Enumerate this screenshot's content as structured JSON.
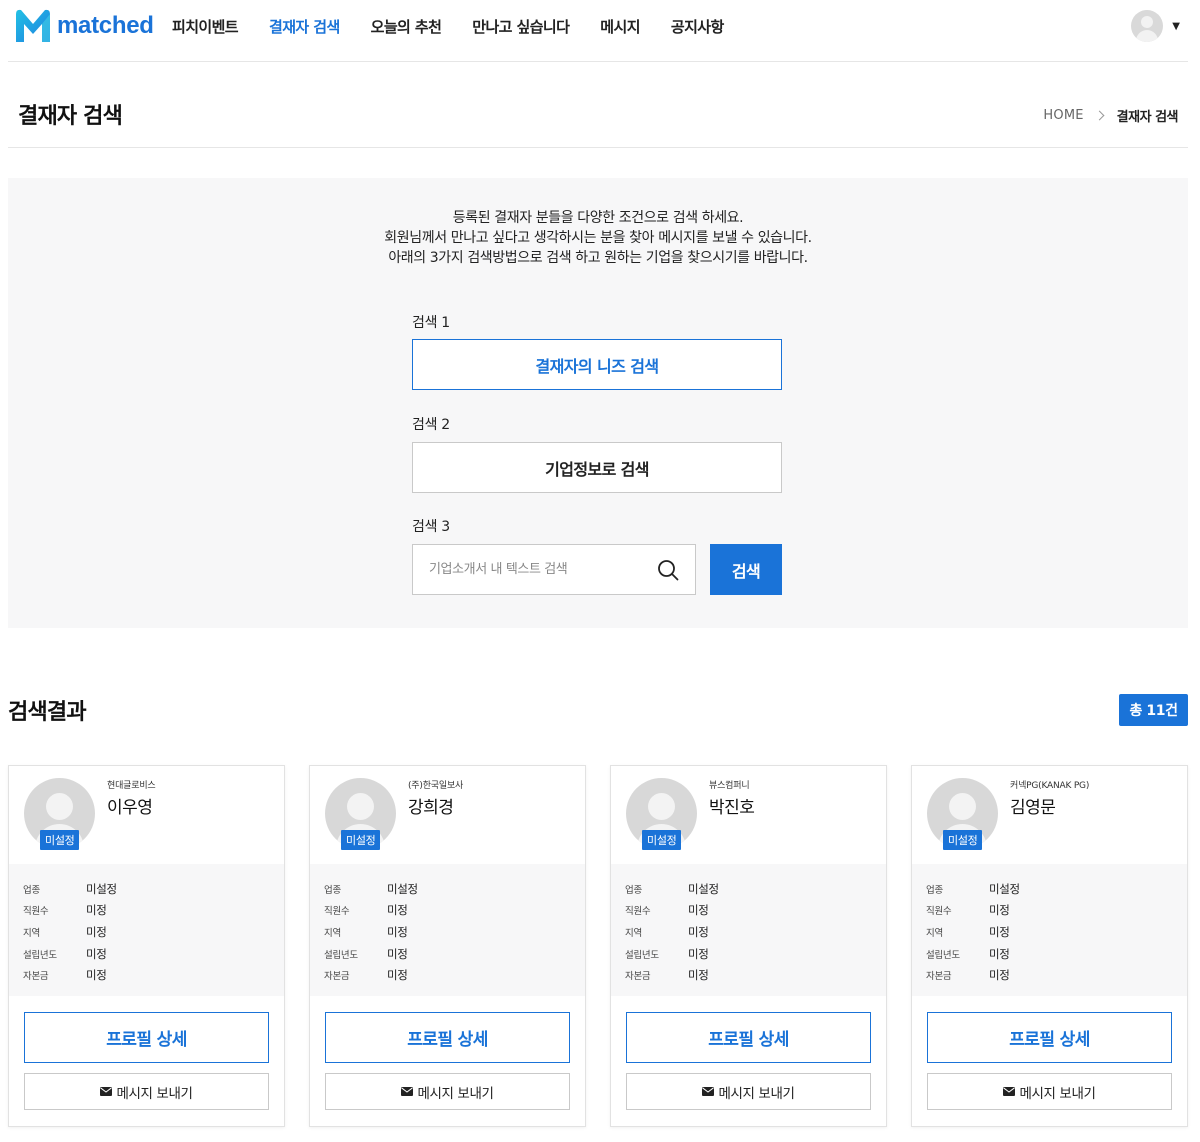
{
  "header": {
    "logo_text": "matched",
    "nav": [
      {
        "label": "피치이벤트",
        "active": false
      },
      {
        "label": "결재자 검색",
        "active": true
      },
      {
        "label": "오늘의 추천",
        "active": false
      },
      {
        "label": "만나고 싶습니다",
        "active": false
      },
      {
        "label": "메시지",
        "active": false
      },
      {
        "label": "공지사항",
        "active": false
      }
    ]
  },
  "page": {
    "title": "결재자 검색",
    "breadcrumb": {
      "home": "HOME",
      "current": "결재자 검색"
    }
  },
  "search": {
    "intro": [
      "등록된 결재자 분들을 다양한 조건으로 검색 하세요.",
      "회원님께서 만나고 싶다고 생각하시는 분을 찾아 메시지를 보낼 수 있습니다.",
      "아래의 3가지 검색방법으로 검색 하고 원하는 기업을 찾으시기를 바랍니다."
    ],
    "search1_label": "검색 1",
    "search1_button": "결재자의 니즈 검색",
    "search2_label": "검색 2",
    "search2_button": "기업정보로 검색",
    "search3_label": "검색 3",
    "search3_placeholder": "기업소개서 내 텍스트 검색",
    "search3_value": "",
    "submit_label": "검색"
  },
  "results": {
    "title": "검색결과",
    "total_label": "총 11건",
    "badge_label": "미설정",
    "profile_button": "프로필 상세",
    "message_button": "메시지 보내기",
    "field_labels": [
      "업종",
      "직원수",
      "지역",
      "설립년도",
      "자본금"
    ],
    "cards": [
      {
        "company": "현대글로비스",
        "name": "이우영",
        "values": [
          "미설정",
          "미정",
          "미정",
          "미정",
          "미정"
        ]
      },
      {
        "company": "(주)한국일보사",
        "name": "강희경",
        "values": [
          "미설정",
          "미정",
          "미정",
          "미정",
          "미정"
        ]
      },
      {
        "company": "뷰스컴퍼니",
        "name": "박진호",
        "values": [
          "미설정",
          "미정",
          "미정",
          "미정",
          "미정"
        ]
      },
      {
        "company": "커넥PG(KANAK PG)",
        "name": "김영문",
        "values": [
          "미설정",
          "미정",
          "미정",
          "미정",
          "미정"
        ]
      }
    ]
  },
  "colors": {
    "accent": "#1a73d8",
    "panel_bg": "#f7f7f8",
    "border": "#c9c9c9"
  },
  "icons": [
    "matched-logo-icon",
    "user-avatar-icon",
    "chevron-down-icon",
    "chevron-right-icon",
    "search-icon",
    "mail-icon"
  ]
}
